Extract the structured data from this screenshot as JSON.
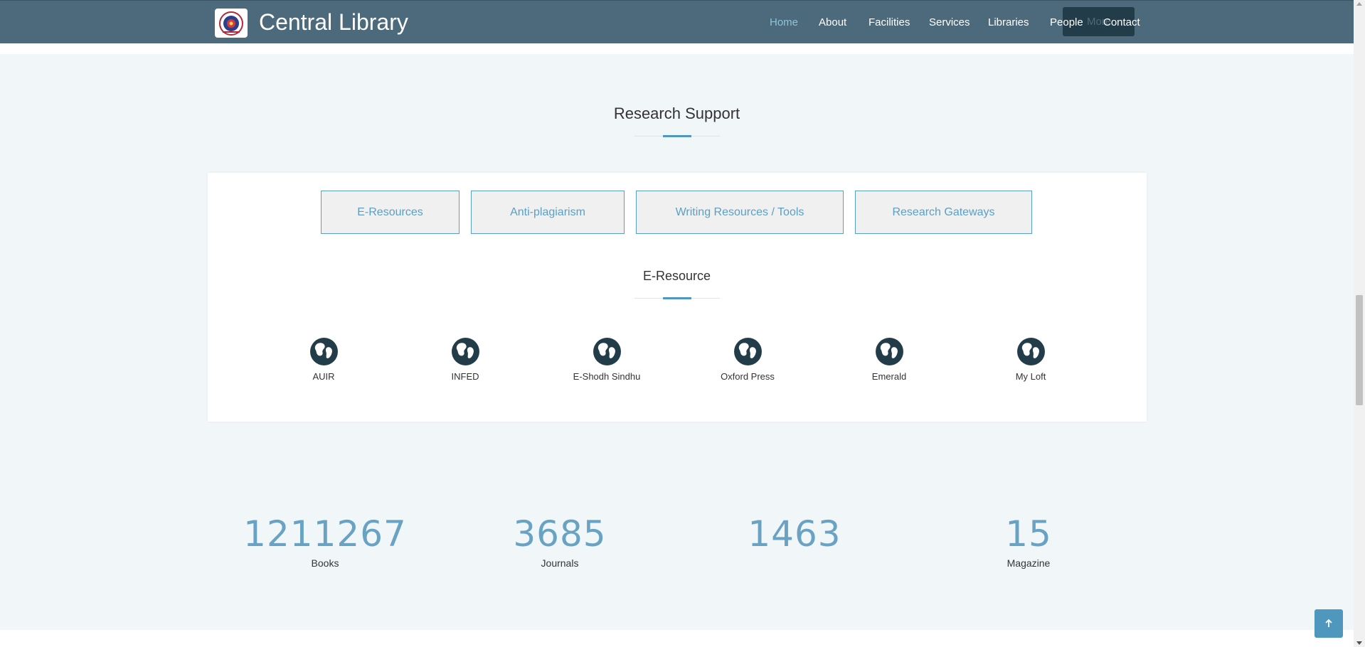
{
  "header": {
    "brand": "Central Library",
    "logo_icon": "university-seal-icon",
    "nav": [
      {
        "label": "Home",
        "active": true
      },
      {
        "label": "About"
      },
      {
        "label": "Facilities"
      },
      {
        "label": "Services"
      },
      {
        "label": "Libraries"
      },
      {
        "label": "People"
      },
      {
        "label": "Contact"
      }
    ],
    "more_button_label": "More"
  },
  "research_support": {
    "title": "Research Support",
    "tabs": [
      {
        "label": "E-Resources"
      },
      {
        "label": "Anti-plagiarism"
      },
      {
        "label": "Writing Resources / Tools"
      },
      {
        "label": "Research Gateways"
      }
    ],
    "subsection_title": "E-Resource",
    "resources": [
      {
        "label": "AUIR",
        "icon": "globe-icon"
      },
      {
        "label": "INFED",
        "icon": "globe-icon"
      },
      {
        "label": "E-Shodh Sindhu",
        "icon": "globe-icon"
      },
      {
        "label": "Oxford Press",
        "icon": "globe-icon"
      },
      {
        "label": "Emerald",
        "icon": "globe-icon"
      },
      {
        "label": "My Loft",
        "icon": "globe-icon"
      }
    ]
  },
  "stats": [
    {
      "number": "1211267",
      "caption": "Books"
    },
    {
      "number": "3685",
      "caption": "Journals"
    },
    {
      "number": "1463",
      "caption": ""
    },
    {
      "number": "15",
      "caption": "Magazine"
    }
  ],
  "colors": {
    "header_bg": "#4c6a7b",
    "accent": "#4f97bd",
    "page_bg": "#f1f6f8",
    "stat_number": "#6aa2c4"
  }
}
